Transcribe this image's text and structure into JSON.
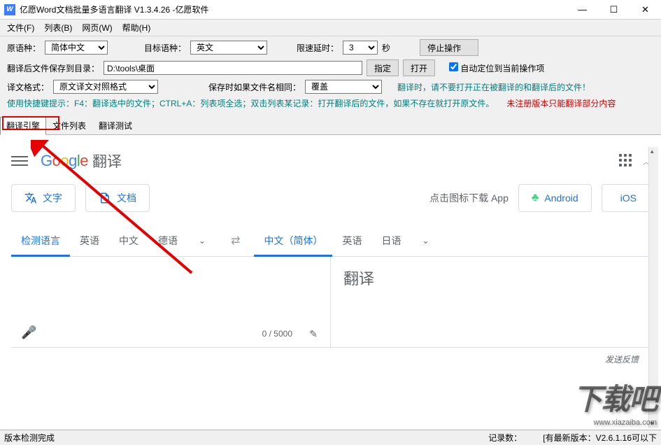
{
  "window": {
    "logo": "W",
    "title": "亿愿Word文档批量多语言翻译 V1.3.4.26 -亿愿软件"
  },
  "menu": {
    "file": "文件(F)",
    "list": "列表(B)",
    "web": "网页(W)",
    "help": "帮助(H)"
  },
  "row1": {
    "src_label": "原语种：",
    "src_value": "简体中文",
    "tgt_label": "目标语种：",
    "tgt_value": "英文",
    "delay_label": "限速延时：",
    "delay_value": "3",
    "delay_unit": "秒",
    "stop_btn": "停止操作"
  },
  "row2": {
    "save_label": "翻译后文件保存到目录：",
    "path": "D:\\tools\\桌面",
    "fix_btn": "指定",
    "open_btn": "打开",
    "auto_label": "自动定位到当前操作项"
  },
  "row3": {
    "fmt_label": "译文格式：",
    "fmt_value": "原文译文对照格式",
    "dup_label": "保存时如果文件名相同：",
    "dup_value": "覆盖",
    "warn": "翻译时，请不要打开正在被翻译的和翻译后的文件！"
  },
  "row4": {
    "hint": "使用快捷键提示：F4：翻译选中的文件；CTRL+A：列表项全选；双击列表某记录：打开翻译后的文件，如果不存在就打开原文件。",
    "unreg": "未注册版本只能翻译部分内容"
  },
  "tabs": {
    "engine": "翻译引擎",
    "files": "文件列表",
    "test": "翻译测试"
  },
  "gt": {
    "trans": "翻译",
    "text_btn": "文字",
    "doc_btn": "文档",
    "promo": "点击图标下载 App",
    "android": "Android",
    "ios": "iOS",
    "src_tabs": {
      "detect": "检测语言",
      "en": "英语",
      "zh": "中文",
      "de": "德语"
    },
    "tgt_tabs": {
      "zh": "中文（简体）",
      "en": "英语",
      "ja": "日语"
    },
    "tgt_ph": "翻译",
    "counter": "0 / 5000",
    "feedback": "发送反馈"
  },
  "watermark": {
    "main": "下载吧",
    "sub": "www.xiazaiba.com"
  },
  "status": {
    "left": "版本检测完成",
    "mid": "记录数：",
    "right": "[有最新版本：V2.6.1.16可以下"
  }
}
